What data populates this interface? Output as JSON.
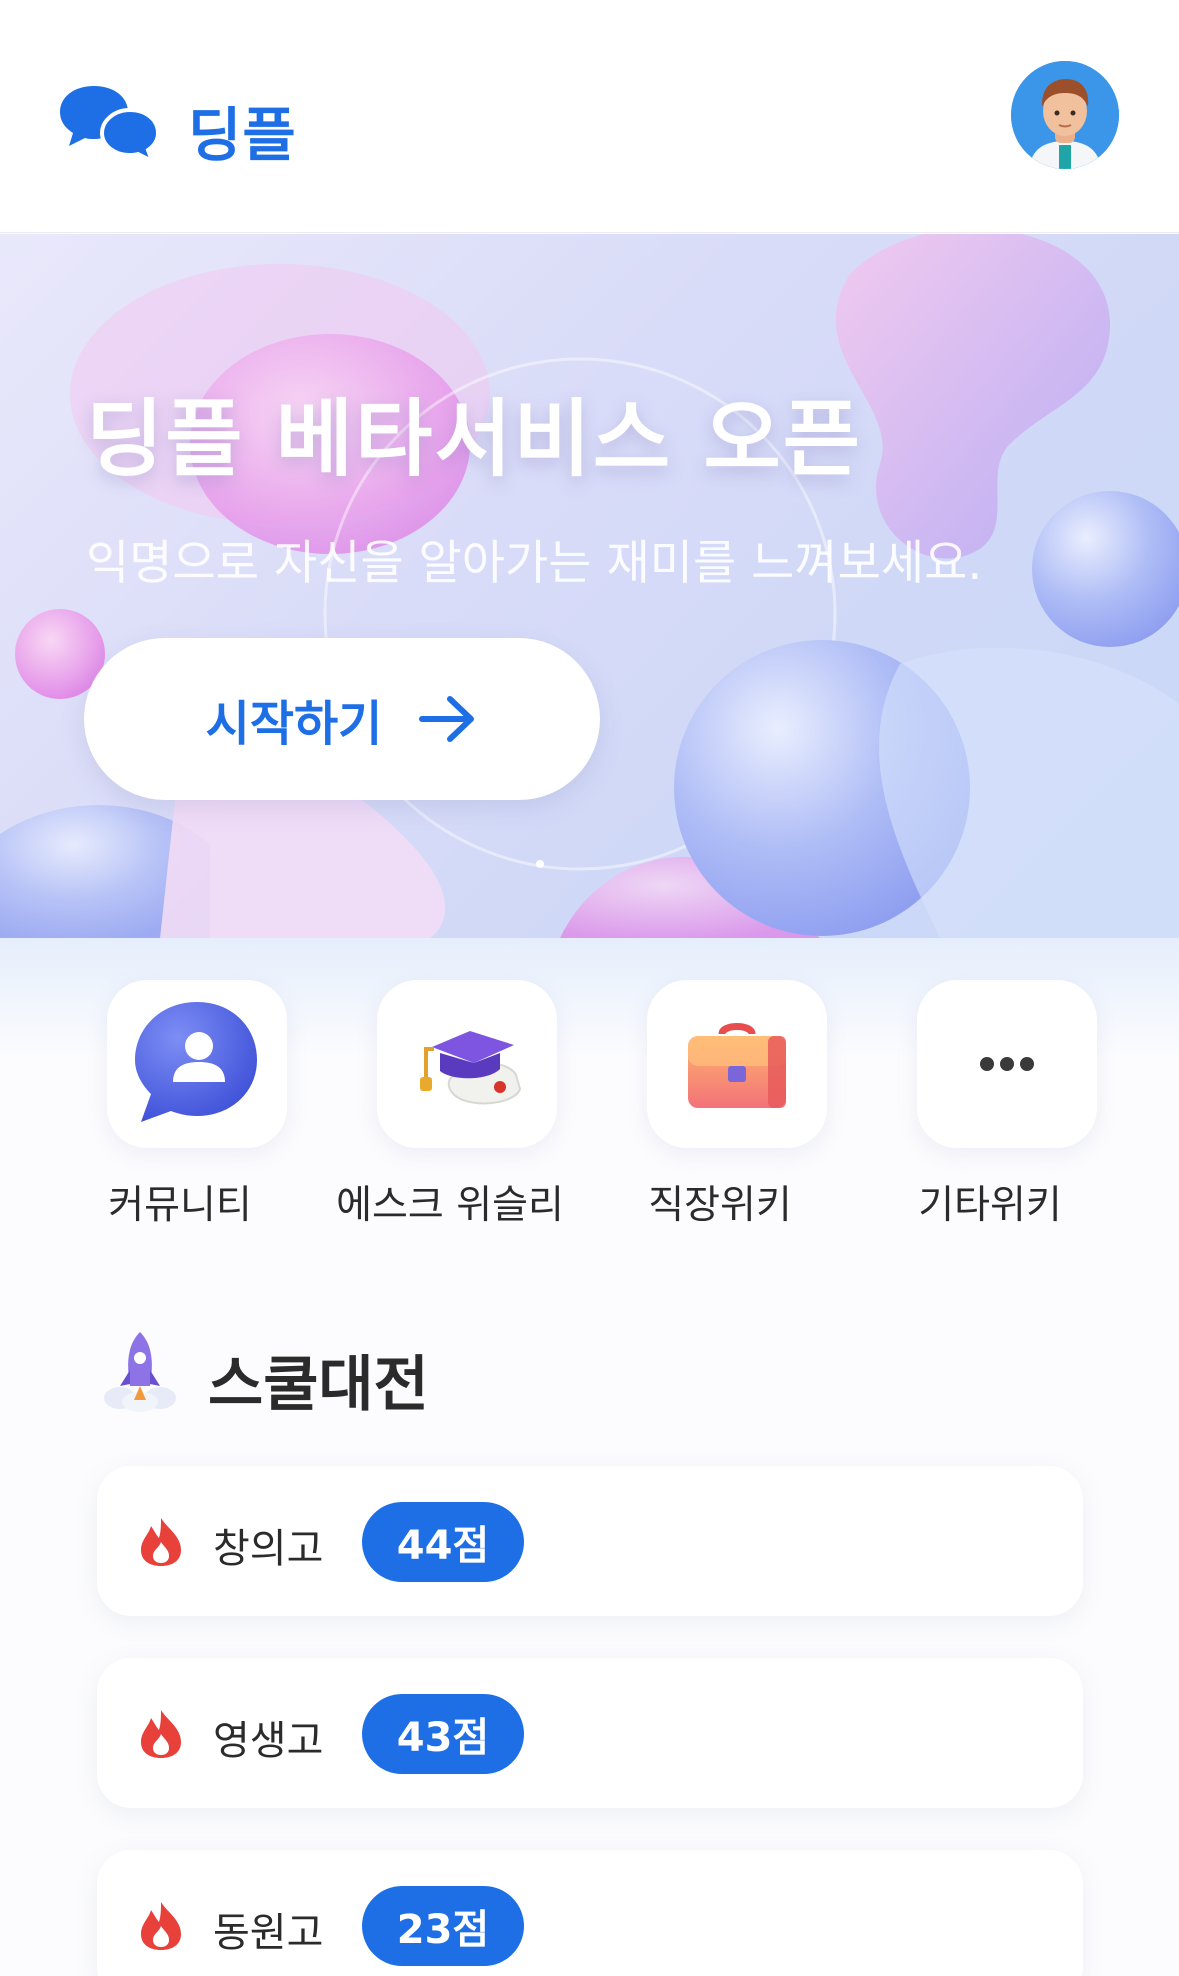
{
  "header": {
    "app_name": "딩플",
    "logo_icon": "chat-bubbles-icon",
    "avatar_icon": "user-avatar"
  },
  "banner": {
    "title": "딩플 베타서비스 오픈",
    "subtitle": "익명으로 자신을 알아가는 재미를 느껴보세요.",
    "button_label": "시작하기",
    "button_icon": "arrow-right-icon"
  },
  "quick_menu": {
    "items": [
      {
        "label": "커뮤니티",
        "icon": "community-chat-icon"
      },
      {
        "label": "에스크 위슬리",
        "icon": "graduation-cap-icon"
      },
      {
        "label": "직장위키",
        "icon": "briefcase-icon"
      },
      {
        "label": "기타위키",
        "icon": "more-dots-icon"
      }
    ]
  },
  "school_battle": {
    "title": "스쿨대전",
    "icon": "rocket-icon",
    "rows": [
      {
        "school": "창의고",
        "score": "44점",
        "icon": "fire-icon"
      },
      {
        "school": "영생고",
        "score": "43점",
        "icon": "fire-icon"
      },
      {
        "school": "동원고",
        "score": "23점",
        "icon": "fire-icon"
      }
    ]
  },
  "colors": {
    "accent": "#1e6fe6",
    "fire": "#e8403a",
    "text": "#2b2b2b"
  }
}
